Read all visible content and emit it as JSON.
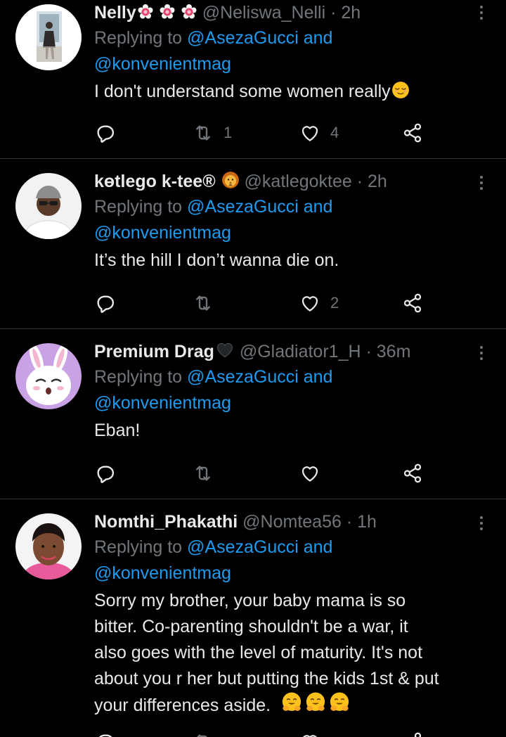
{
  "tweets": [
    {
      "display_name": "Nelly",
      "name_emojis": [
        "flower-emoji",
        "flower-emoji",
        "flower-emoji"
      ],
      "handle": "@Neliswa_Nelli",
      "separator": "·",
      "time": "2h",
      "replying_prefix": "Replying to",
      "replying_to_1": "@AsezaGucci",
      "replying_and": "and",
      "replying_to_2": "@konvenientmag",
      "text": "I don't understand some women really",
      "text_emoji": "relieved-face-emoji",
      "retweets": "1",
      "likes": "4"
    },
    {
      "display_name": "kɵtlego k-tee®",
      "name_emojis": [
        "lion-face-emoji"
      ],
      "handle": "@katlegoktee",
      "separator": "·",
      "time": "2h",
      "replying_prefix": "Replying to",
      "replying_to_1": "@AsezaGucci",
      "replying_and": "and",
      "replying_to_2": "@konvenientmag",
      "text": "It’s the hill I don’t wanna die on.",
      "retweets": "",
      "likes": "2"
    },
    {
      "display_name": "Premium Drag",
      "name_emojis": [
        "black-heart-emoji"
      ],
      "handle": "@Gladiator1_H",
      "separator": "·",
      "time": "36m",
      "replying_prefix": "Replying to",
      "replying_to_1": "@AsezaGucci",
      "replying_and": "and",
      "replying_to_2": "@konvenientmag",
      "text": "Eban!",
      "retweets": "",
      "likes": ""
    },
    {
      "display_name": "Nomthi_Phakathi",
      "handle": "@Nomtea56",
      "separator": "·",
      "time": "1h",
      "replying_prefix": "Replying to",
      "replying_to_1": "@AsezaGucci",
      "replying_and": "and",
      "replying_to_2": "@konvenientmag",
      "text_lines": [
        "Sorry my brother, your baby mama is so",
        "bitter. Co-parenting shouldn't be a war, it",
        "also goes with the level of maturity. It's not",
        "about you r her but putting the kids 1st & put",
        "your differences aside."
      ],
      "text_emojis": [
        "hugging-face-emoji",
        "hugging-face-emoji",
        "hugging-face-emoji"
      ]
    }
  ],
  "colors": {
    "background": "#000000",
    "primary_text": "#e7e9ea",
    "secondary_text": "#71767b",
    "link": "#1d9bf0",
    "divider": "#2f3336"
  }
}
